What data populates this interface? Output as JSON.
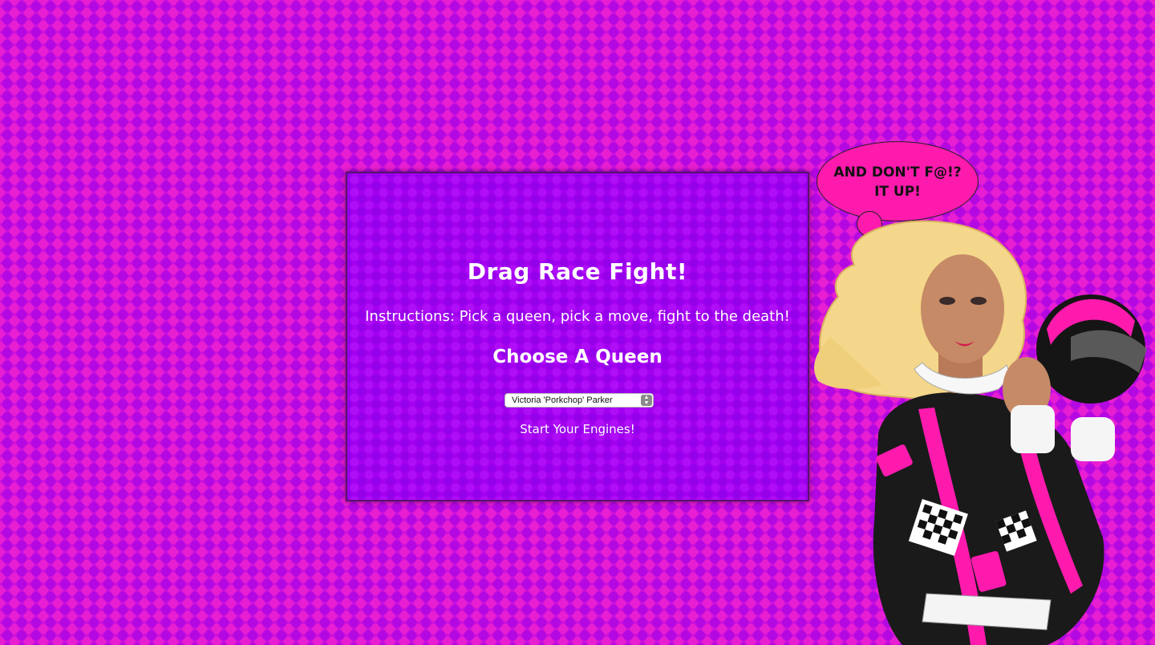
{
  "game": {
    "title": "Drag Race Fight!",
    "instructions": "Instructions: Pick a queen, pick a move, fight to the death!",
    "choose_heading": "Choose A Queen",
    "queen_select": {
      "selected": "Victoria 'Porkchop' Parker"
    },
    "start_label": "Start Your Engines!"
  },
  "bubble": {
    "text": "AND DON'T F@!? IT UP!"
  },
  "colors": {
    "background": "#cc11dd",
    "panel": "#a300f0",
    "bubble": "#ff1aae",
    "accent_pink": "#ff1aae",
    "suit_black": "#1a1a1a"
  }
}
